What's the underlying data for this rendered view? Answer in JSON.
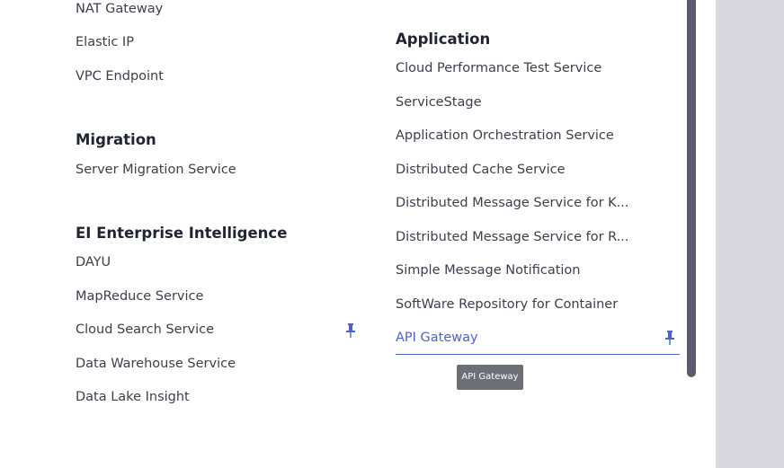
{
  "left_column": {
    "network_items": [
      "NAT Gateway",
      "Elastic IP",
      "VPC Endpoint"
    ],
    "migration": {
      "heading": "Migration",
      "items": [
        "Server Migration Service"
      ]
    },
    "ei": {
      "heading": "EI Enterprise Intelligence",
      "items": [
        "DAYU",
        "MapReduce Service",
        "Cloud Search Service",
        "Data Warehouse Service",
        "Data Lake Insight"
      ],
      "pinned_index": 2
    }
  },
  "right_column": {
    "application": {
      "heading": "Application",
      "items": [
        "Cloud Performance Test Service",
        "ServiceStage",
        "Application Orchestration Service",
        "Distributed Cache Service",
        "Distributed Message Service for K...",
        "Distributed Message Service for R...",
        "Simple Message Notification",
        "SoftWare Repository for Container",
        "API Gateway"
      ],
      "active_index": 8
    }
  },
  "tooltip": {
    "text": "API Gateway"
  },
  "colors": {
    "accent": "#4f63c7",
    "pin": "#4f63c7",
    "scrollbar": "#5b5d6e",
    "gutter": "#d8d8de"
  },
  "icons": {
    "pin": "pin-icon"
  }
}
